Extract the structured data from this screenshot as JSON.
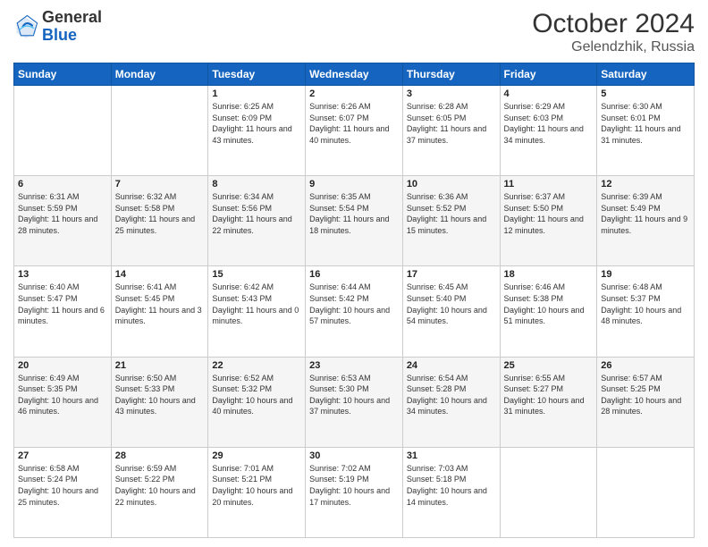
{
  "header": {
    "logo": {
      "general": "General",
      "blue": "Blue"
    },
    "month": "October 2024",
    "location": "Gelendzhik, Russia"
  },
  "days_of_week": [
    "Sunday",
    "Monday",
    "Tuesday",
    "Wednesday",
    "Thursday",
    "Friday",
    "Saturday"
  ],
  "weeks": [
    [
      {
        "day": "",
        "sunrise": "",
        "sunset": "",
        "daylight": ""
      },
      {
        "day": "",
        "sunrise": "",
        "sunset": "",
        "daylight": ""
      },
      {
        "day": "1",
        "sunrise": "Sunrise: 6:25 AM",
        "sunset": "Sunset: 6:09 PM",
        "daylight": "Daylight: 11 hours and 43 minutes."
      },
      {
        "day": "2",
        "sunrise": "Sunrise: 6:26 AM",
        "sunset": "Sunset: 6:07 PM",
        "daylight": "Daylight: 11 hours and 40 minutes."
      },
      {
        "day": "3",
        "sunrise": "Sunrise: 6:28 AM",
        "sunset": "Sunset: 6:05 PM",
        "daylight": "Daylight: 11 hours and 37 minutes."
      },
      {
        "day": "4",
        "sunrise": "Sunrise: 6:29 AM",
        "sunset": "Sunset: 6:03 PM",
        "daylight": "Daylight: 11 hours and 34 minutes."
      },
      {
        "day": "5",
        "sunrise": "Sunrise: 6:30 AM",
        "sunset": "Sunset: 6:01 PM",
        "daylight": "Daylight: 11 hours and 31 minutes."
      }
    ],
    [
      {
        "day": "6",
        "sunrise": "Sunrise: 6:31 AM",
        "sunset": "Sunset: 5:59 PM",
        "daylight": "Daylight: 11 hours and 28 minutes."
      },
      {
        "day": "7",
        "sunrise": "Sunrise: 6:32 AM",
        "sunset": "Sunset: 5:58 PM",
        "daylight": "Daylight: 11 hours and 25 minutes."
      },
      {
        "day": "8",
        "sunrise": "Sunrise: 6:34 AM",
        "sunset": "Sunset: 5:56 PM",
        "daylight": "Daylight: 11 hours and 22 minutes."
      },
      {
        "day": "9",
        "sunrise": "Sunrise: 6:35 AM",
        "sunset": "Sunset: 5:54 PM",
        "daylight": "Daylight: 11 hours and 18 minutes."
      },
      {
        "day": "10",
        "sunrise": "Sunrise: 6:36 AM",
        "sunset": "Sunset: 5:52 PM",
        "daylight": "Daylight: 11 hours and 15 minutes."
      },
      {
        "day": "11",
        "sunrise": "Sunrise: 6:37 AM",
        "sunset": "Sunset: 5:50 PM",
        "daylight": "Daylight: 11 hours and 12 minutes."
      },
      {
        "day": "12",
        "sunrise": "Sunrise: 6:39 AM",
        "sunset": "Sunset: 5:49 PM",
        "daylight": "Daylight: 11 hours and 9 minutes."
      }
    ],
    [
      {
        "day": "13",
        "sunrise": "Sunrise: 6:40 AM",
        "sunset": "Sunset: 5:47 PM",
        "daylight": "Daylight: 11 hours and 6 minutes."
      },
      {
        "day": "14",
        "sunrise": "Sunrise: 6:41 AM",
        "sunset": "Sunset: 5:45 PM",
        "daylight": "Daylight: 11 hours and 3 minutes."
      },
      {
        "day": "15",
        "sunrise": "Sunrise: 6:42 AM",
        "sunset": "Sunset: 5:43 PM",
        "daylight": "Daylight: 11 hours and 0 minutes."
      },
      {
        "day": "16",
        "sunrise": "Sunrise: 6:44 AM",
        "sunset": "Sunset: 5:42 PM",
        "daylight": "Daylight: 10 hours and 57 minutes."
      },
      {
        "day": "17",
        "sunrise": "Sunrise: 6:45 AM",
        "sunset": "Sunset: 5:40 PM",
        "daylight": "Daylight: 10 hours and 54 minutes."
      },
      {
        "day": "18",
        "sunrise": "Sunrise: 6:46 AM",
        "sunset": "Sunset: 5:38 PM",
        "daylight": "Daylight: 10 hours and 51 minutes."
      },
      {
        "day": "19",
        "sunrise": "Sunrise: 6:48 AM",
        "sunset": "Sunset: 5:37 PM",
        "daylight": "Daylight: 10 hours and 48 minutes."
      }
    ],
    [
      {
        "day": "20",
        "sunrise": "Sunrise: 6:49 AM",
        "sunset": "Sunset: 5:35 PM",
        "daylight": "Daylight: 10 hours and 46 minutes."
      },
      {
        "day": "21",
        "sunrise": "Sunrise: 6:50 AM",
        "sunset": "Sunset: 5:33 PM",
        "daylight": "Daylight: 10 hours and 43 minutes."
      },
      {
        "day": "22",
        "sunrise": "Sunrise: 6:52 AM",
        "sunset": "Sunset: 5:32 PM",
        "daylight": "Daylight: 10 hours and 40 minutes."
      },
      {
        "day": "23",
        "sunrise": "Sunrise: 6:53 AM",
        "sunset": "Sunset: 5:30 PM",
        "daylight": "Daylight: 10 hours and 37 minutes."
      },
      {
        "day": "24",
        "sunrise": "Sunrise: 6:54 AM",
        "sunset": "Sunset: 5:28 PM",
        "daylight": "Daylight: 10 hours and 34 minutes."
      },
      {
        "day": "25",
        "sunrise": "Sunrise: 6:55 AM",
        "sunset": "Sunset: 5:27 PM",
        "daylight": "Daylight: 10 hours and 31 minutes."
      },
      {
        "day": "26",
        "sunrise": "Sunrise: 6:57 AM",
        "sunset": "Sunset: 5:25 PM",
        "daylight": "Daylight: 10 hours and 28 minutes."
      }
    ],
    [
      {
        "day": "27",
        "sunrise": "Sunrise: 6:58 AM",
        "sunset": "Sunset: 5:24 PM",
        "daylight": "Daylight: 10 hours and 25 minutes."
      },
      {
        "day": "28",
        "sunrise": "Sunrise: 6:59 AM",
        "sunset": "Sunset: 5:22 PM",
        "daylight": "Daylight: 10 hours and 22 minutes."
      },
      {
        "day": "29",
        "sunrise": "Sunrise: 7:01 AM",
        "sunset": "Sunset: 5:21 PM",
        "daylight": "Daylight: 10 hours and 20 minutes."
      },
      {
        "day": "30",
        "sunrise": "Sunrise: 7:02 AM",
        "sunset": "Sunset: 5:19 PM",
        "daylight": "Daylight: 10 hours and 17 minutes."
      },
      {
        "day": "31",
        "sunrise": "Sunrise: 7:03 AM",
        "sunset": "Sunset: 5:18 PM",
        "daylight": "Daylight: 10 hours and 14 minutes."
      },
      {
        "day": "",
        "sunrise": "",
        "sunset": "",
        "daylight": ""
      },
      {
        "day": "",
        "sunrise": "",
        "sunset": "",
        "daylight": ""
      }
    ]
  ]
}
